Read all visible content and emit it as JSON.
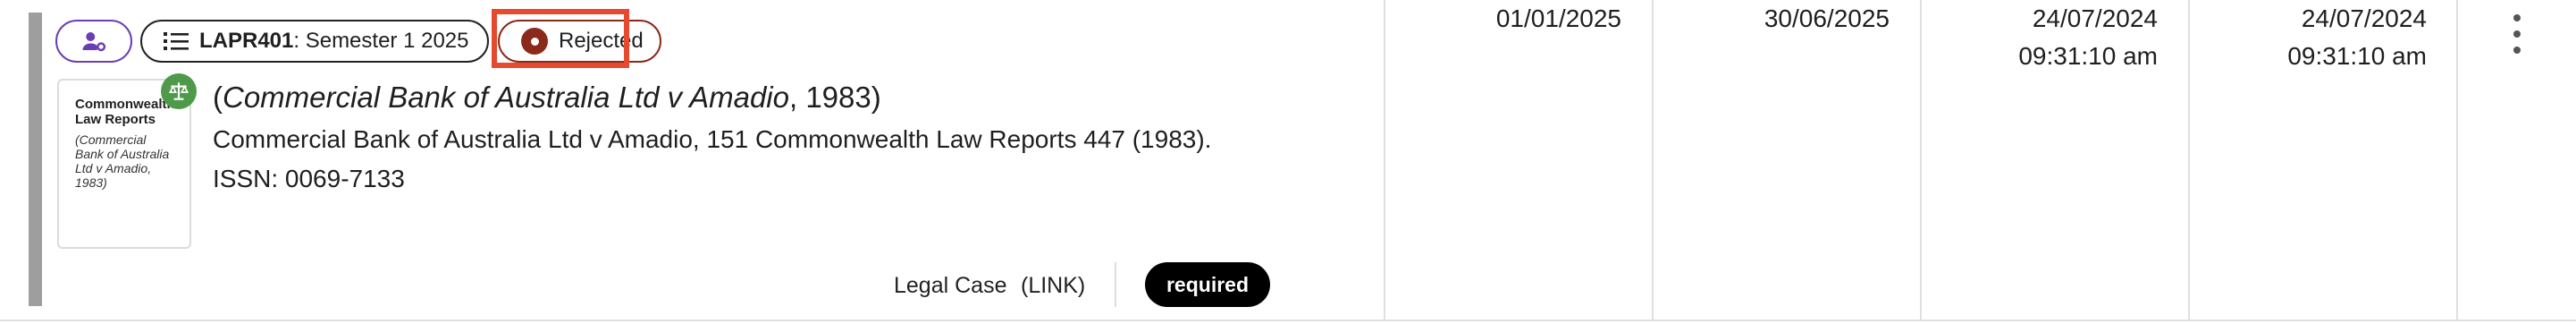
{
  "item": {
    "course_code": "LAPR401",
    "course_term": ": Semester 1 2025",
    "status": "Rejected",
    "thumbnail": {
      "title": "Commonwealth Law Reports",
      "subtitle": "(Commercial Bank of Australia Ltd v Amadio, 1983)"
    },
    "title_open": "(",
    "title_italic": "Commercial Bank of Australia Ltd v Amadio",
    "title_rest": ", 1983)",
    "citation": "Commercial Bank of Australia Ltd v Amadio, 151 Commonwealth Law Reports 447 (1983).",
    "issn": "ISSN: 0069-7133",
    "type": "Legal Case",
    "link_label": "(LINK)",
    "importance": "required"
  },
  "columns": {
    "start_date": "01/01/2025",
    "end_date": "30/06/2025",
    "created_date": "24/07/2024",
    "created_time": "09:31:10 am",
    "updated_date": "24/07/2024",
    "updated_time": "09:31:10 am"
  },
  "colors": {
    "status_rejected": "#8b2a1a",
    "highlight": "#e64a2e",
    "user_chip": "#6a3fb5",
    "badge": "#4e9a4a"
  },
  "icons": [
    "user-gear-icon",
    "list-icon",
    "status-dot-icon",
    "scales-icon",
    "more-vert-icon"
  ]
}
